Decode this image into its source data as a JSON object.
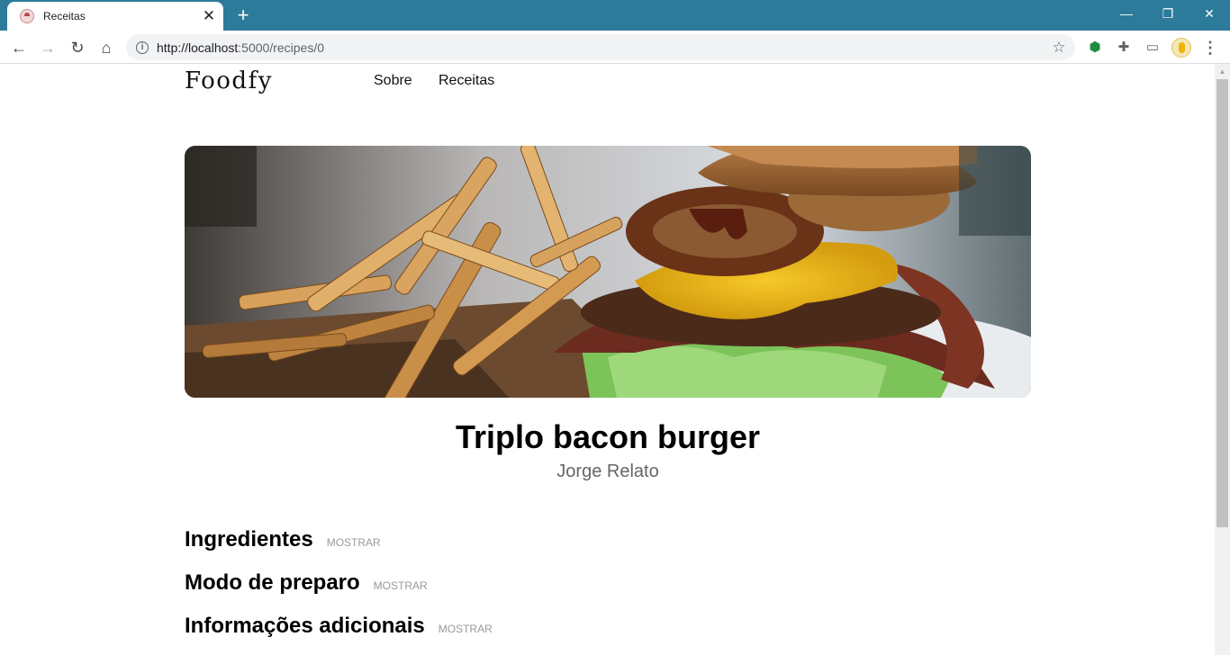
{
  "browser": {
    "tab": {
      "title": "Receitas",
      "close": "✕"
    },
    "new_tab": "+",
    "window_controls": {
      "minimize": "—",
      "restore": "❐",
      "close": "✕"
    },
    "nav": {
      "back": "←",
      "forward": "→",
      "reload": "↻",
      "home": "⌂"
    },
    "address": {
      "host": "http://localhost",
      "path": ":5000/recipes/0",
      "info_icon": "i"
    },
    "bookmark_icon": "☆",
    "extensions": {
      "shield": "⬢",
      "puzzle": "✚",
      "cast": "▭"
    },
    "menu": "⋮"
  },
  "site": {
    "logo": "Foodfy",
    "nav": {
      "about": "Sobre",
      "recipes": "Receitas"
    }
  },
  "recipe": {
    "title": "Triplo bacon burger",
    "author": "Jorge Relato",
    "sections": [
      {
        "title": "Ingredientes",
        "toggle": "MOSTRAR"
      },
      {
        "title": "Modo de preparo",
        "toggle": "MOSTRAR"
      },
      {
        "title": "Informações adicionais",
        "toggle": "MOSTRAR"
      }
    ]
  },
  "colors": {
    "chrome_tabbar": "#2d7b9a",
    "toggle_text": "#999999",
    "author_text": "#666666"
  }
}
